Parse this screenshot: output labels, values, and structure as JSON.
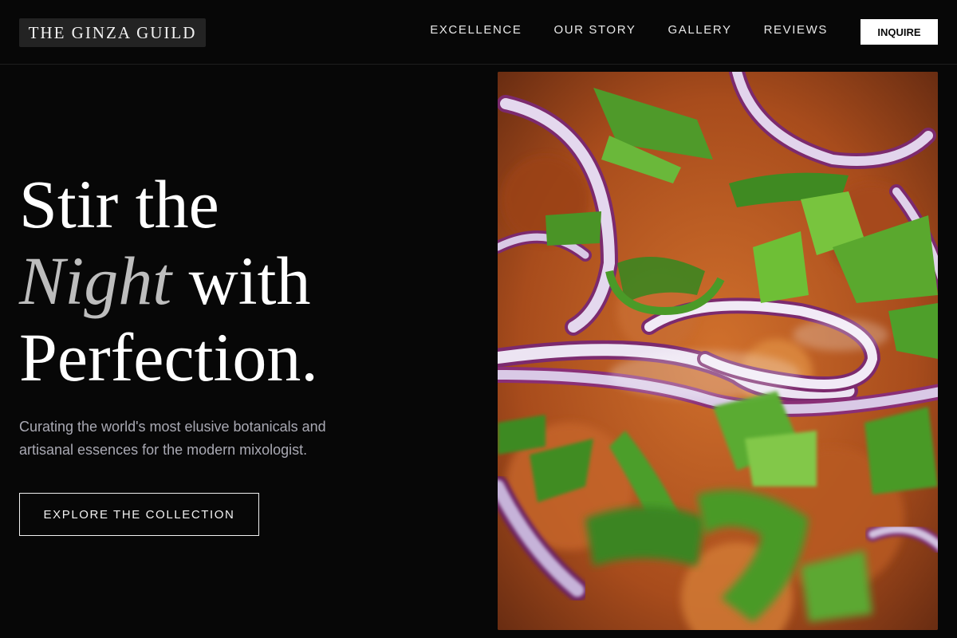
{
  "brand": {
    "name": "THE GINZA GUILD"
  },
  "nav": {
    "links": [
      "EXCELLENCE",
      "OUR STORY",
      "GALLERY",
      "REVIEWS"
    ],
    "cta_label": "INQUIRE"
  },
  "hero": {
    "headline_line1": "Stir the",
    "headline_em": "Night",
    "headline_line2_rest": " with",
    "headline_line3": "Perfection.",
    "subtext": "Curating the world's most elusive botanicals and artisanal essences for the modern mixologist.",
    "cta_label": "EXPLORE THE COLLECTION",
    "image": {
      "subject": "close-up food photo with sliced red onion and green scallions",
      "colors": {
        "base": "#b5561f",
        "onion": "#c9b6dd",
        "onion_edge": "#7c2a6e",
        "scallion": "#4f9a2a"
      }
    }
  },
  "colors": {
    "background": "#070707",
    "text": "#ffffff",
    "muted_text": "#a9a9b3",
    "italic_accent": "#bdbdbd"
  }
}
